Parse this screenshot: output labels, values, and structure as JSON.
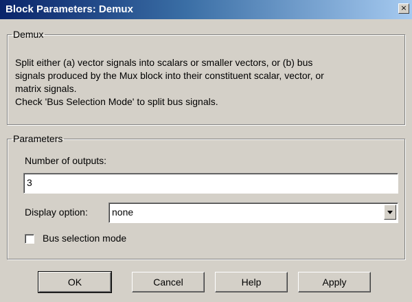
{
  "window": {
    "title": "Block Parameters: Demux",
    "close_glyph": "×"
  },
  "demux_group": {
    "legend": "Demux",
    "description": "Split either (a) vector signals into scalars or smaller vectors, or (b) bus\nsignals produced by the Mux block into their constituent scalar, vector, or\nmatrix signals.\nCheck 'Bus Selection Mode' to split bus signals."
  },
  "parameters_group": {
    "legend": "Parameters",
    "num_outputs_label": "Number of outputs:",
    "num_outputs_value": "3",
    "display_option_label": "Display option:",
    "display_option_value": "none",
    "bus_selection_label": "Bus selection mode",
    "bus_selection_checked": false
  },
  "buttons": {
    "ok": "OK",
    "cancel": "Cancel",
    "help": "Help",
    "apply": "Apply"
  }
}
